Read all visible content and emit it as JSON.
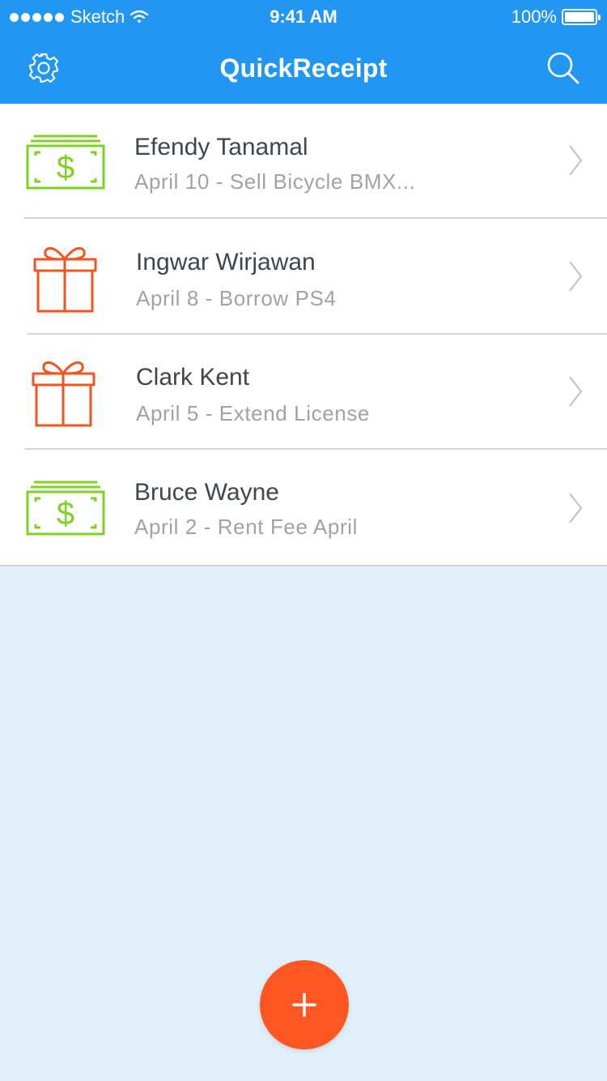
{
  "status_bar": {
    "carrier": "Sketch",
    "time": "9:41 AM",
    "battery": "100%"
  },
  "navbar": {
    "title": "QuickReceipt",
    "settings_icon": "gear-icon",
    "search_icon": "search-icon"
  },
  "receipts": [
    {
      "name": "Efendy Tanamal",
      "detail": "April 10 - Sell Bicycle BMX...",
      "icon": "money-icon"
    },
    {
      "name": "Ingwar Wirjawan",
      "detail": "April 8 - Borrow PS4",
      "icon": "gift-icon"
    },
    {
      "name": "Clark Kent",
      "detail": "April 5 - Extend License",
      "icon": "gift-icon"
    },
    {
      "name": "Bruce Wayne",
      "detail": "April 2 - Rent Fee April",
      "icon": "money-icon"
    }
  ],
  "fab": {
    "icon": "plus-icon"
  },
  "colors": {
    "primary": "#2196f3",
    "accent": "#ff5722",
    "money": "#7ed321",
    "gift": "#f0561d",
    "background": "#e1effb"
  }
}
